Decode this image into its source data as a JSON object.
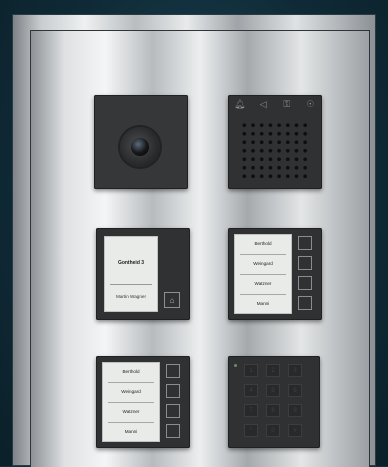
{
  "camera": {
    "icon": "camera-lens-icon"
  },
  "speaker": {
    "icons": [
      "bell-icon",
      "speaker-icon",
      "key-icon",
      "accessibility-icon"
    ]
  },
  "bell_module": {
    "heading": "Gontheid  3",
    "name": "Martin Wagner",
    "icon": "bell-icon"
  },
  "names_top": {
    "names": [
      "Berthold",
      "Weingard",
      "Watzner",
      "Manni"
    ]
  },
  "names_bottom": {
    "names": [
      "Berthold",
      "Weingard",
      "Watzner",
      "Manni"
    ]
  },
  "keypad": {
    "keys": [
      "1",
      "2",
      "3",
      "4",
      "5",
      "6",
      "7",
      "8",
      "9",
      "*",
      "0",
      "#"
    ]
  }
}
